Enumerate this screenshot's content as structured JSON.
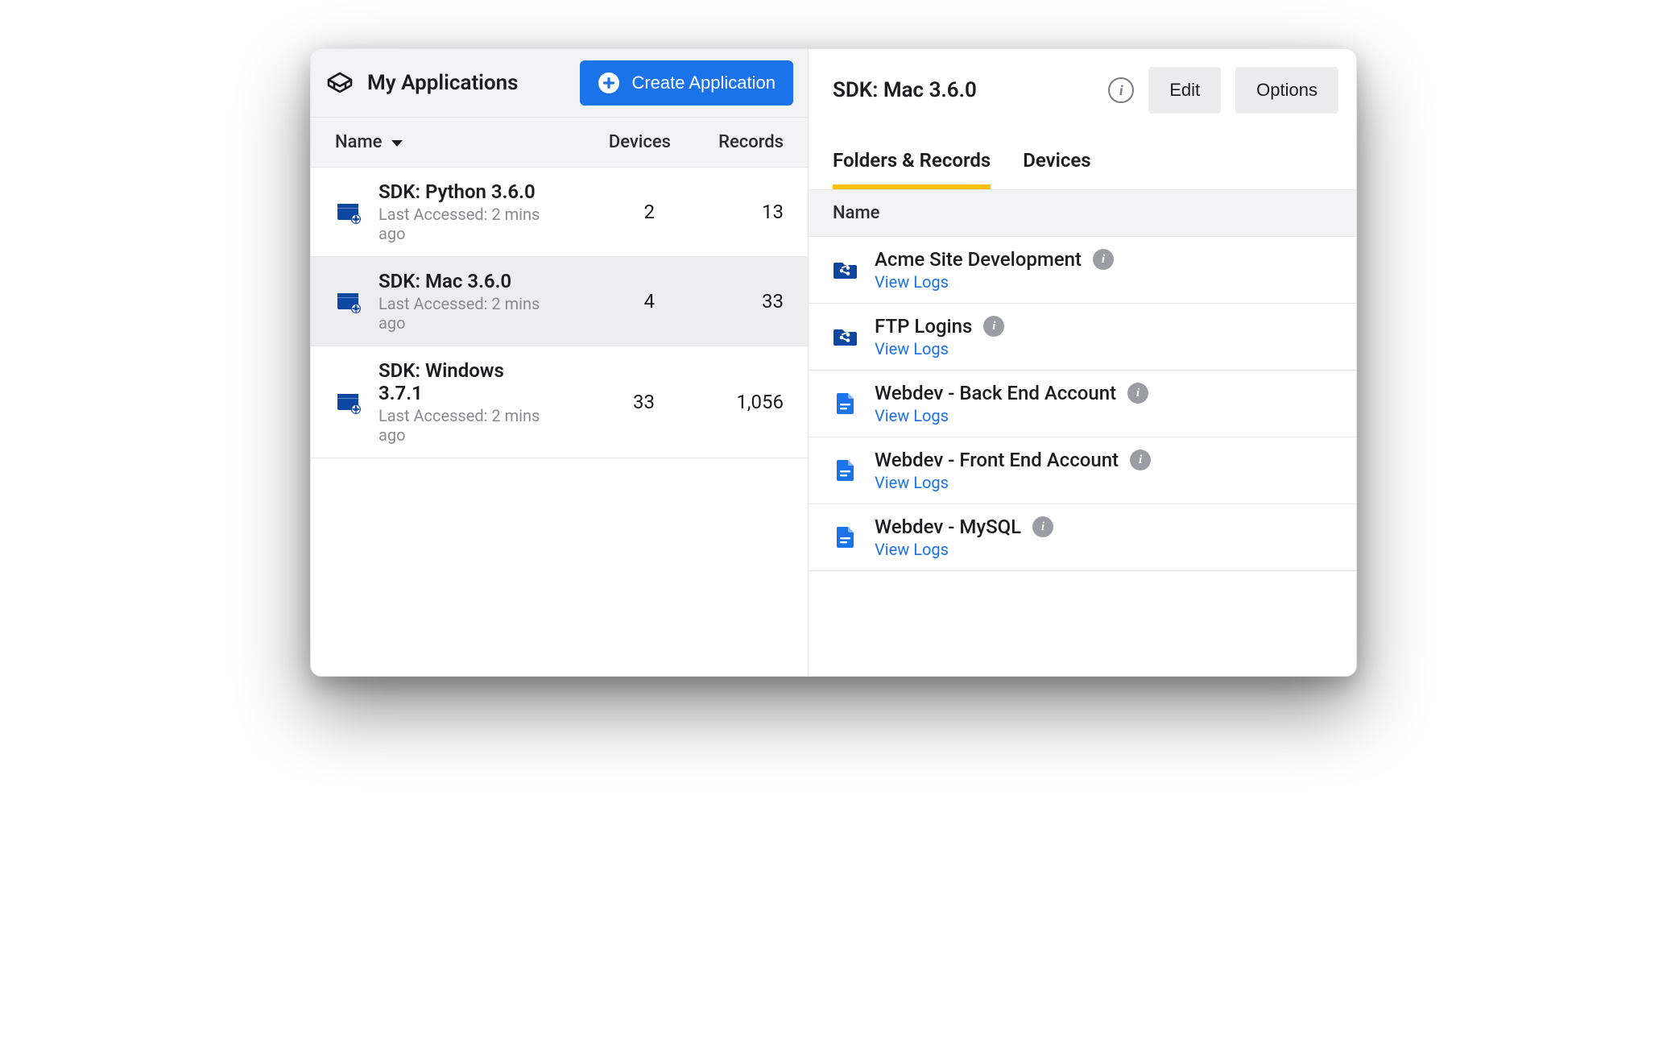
{
  "header": {
    "title": "My Applications",
    "create_label": "Create Application"
  },
  "columns": {
    "name": "Name",
    "devices": "Devices",
    "records": "Records"
  },
  "apps": [
    {
      "name": "SDK: Python 3.6.0",
      "sub": "Last Accessed: 2 mins ago",
      "devices": "2",
      "records": "13",
      "selected": false
    },
    {
      "name": "SDK: Mac 3.6.0",
      "sub": "Last Accessed: 2 mins ago",
      "devices": "4",
      "records": "33",
      "selected": true
    },
    {
      "name": "SDK: Windows 3.7.1",
      "sub": "Last Accessed: 2 mins ago",
      "devices": "33",
      "records": "1,056",
      "selected": false
    }
  ],
  "detail": {
    "title": "SDK: Mac 3.6.0",
    "edit_label": "Edit",
    "options_label": "Options",
    "tabs": {
      "folders": "Folders & Records",
      "devices": "Devices"
    },
    "subheader_name": "Name",
    "view_logs_label": "View Logs"
  },
  "records": [
    {
      "name": "Acme Site Development",
      "icon": "share-folder"
    },
    {
      "name": "FTP Logins",
      "icon": "share-folder"
    },
    {
      "name": "Webdev - Back End Account",
      "icon": "doc"
    },
    {
      "name": "Webdev - Front End Account",
      "icon": "doc"
    },
    {
      "name": "Webdev - MySQL",
      "icon": "doc"
    }
  ]
}
